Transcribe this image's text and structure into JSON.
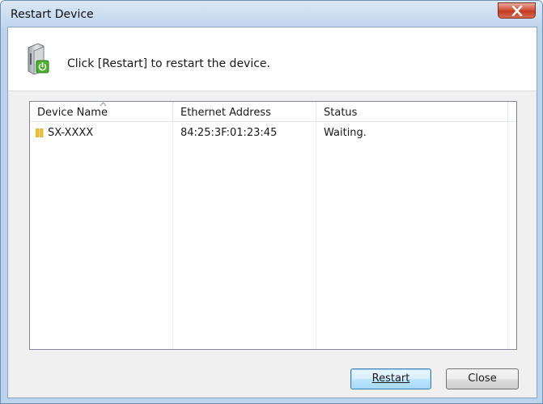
{
  "window": {
    "title": "Restart Device"
  },
  "header": {
    "instruction": "Click [Restart] to restart the device."
  },
  "table": {
    "columns": [
      "Device Name",
      "Ethernet Address",
      "Status"
    ],
    "rows": [
      {
        "device_name": "SX-XXXX",
        "ethernet_address": "84:25:3F:01:23:45",
        "status": "Waiting."
      }
    ]
  },
  "buttons": {
    "restart": "Restart",
    "close": "Close"
  }
}
